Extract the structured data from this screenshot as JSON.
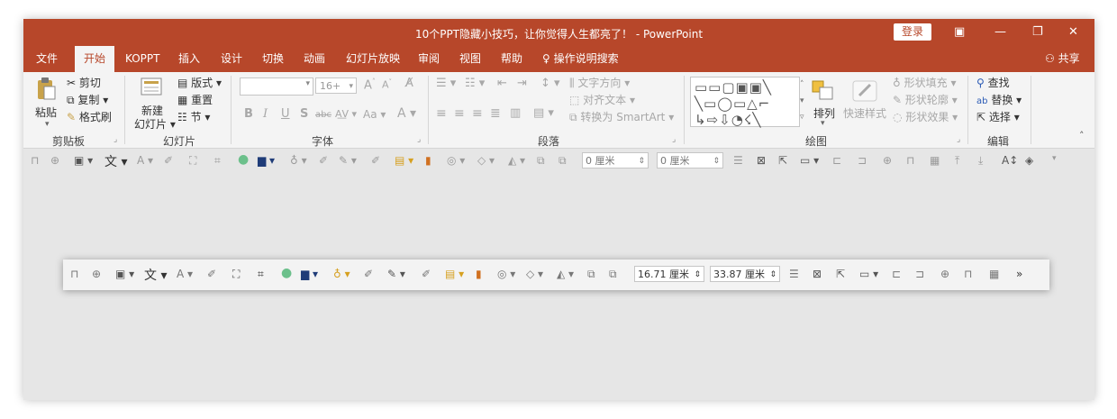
{
  "title": "10个PPT隐藏小技巧，让你觉得人生都亮了！ - PowerPoint",
  "login_label": "登录",
  "window_icons": [
    "ribbon-display-icon",
    "minimize-icon",
    "restore-icon",
    "close-icon"
  ],
  "tabs": [
    "文件",
    "开始",
    "KOPPT",
    "插入",
    "设计",
    "切换",
    "动画",
    "幻灯片放映",
    "审阅",
    "视图",
    "帮助"
  ],
  "active_tab": "开始",
  "tell_me": "操作说明搜索",
  "share_label": "共享",
  "ribbon": {
    "clipboard": {
      "label": "剪贴板",
      "paste": "粘贴",
      "cut": "剪切",
      "copy": "复制",
      "format_painter": "格式刷"
    },
    "slides": {
      "label": "幻灯片",
      "new_slide_1": "新建",
      "new_slide_2": "幻灯片",
      "layout": "版式",
      "reset": "重置",
      "section": "节"
    },
    "font": {
      "label": "字体",
      "size": "16+",
      "bold": "B",
      "italic": "I",
      "underline": "U",
      "shadow": "S",
      "strike": "abc",
      "font_color": "A",
      "case": "Aa"
    },
    "paragraph": {
      "label": "段落",
      "text_direction": "文字方向",
      "align_text": "对齐文本",
      "smartart": "转换为 SmartArt"
    },
    "drawing": {
      "label": "绘图",
      "arrange": "排列",
      "quick_styles": "快速样式",
      "shape_fill": "形状填充",
      "shape_outline": "形状轮廓",
      "shape_effects": "形状效果"
    },
    "editing": {
      "label": "编辑",
      "find": "查找",
      "replace": "替换",
      "select": "选择"
    }
  },
  "qa_toolbar": {
    "height_value": "0 厘米",
    "width_value": "0 厘米"
  },
  "floating_toolbar": {
    "height_value": "16.71 厘米",
    "width_value": "33.87 厘米",
    "overflow": "»"
  }
}
